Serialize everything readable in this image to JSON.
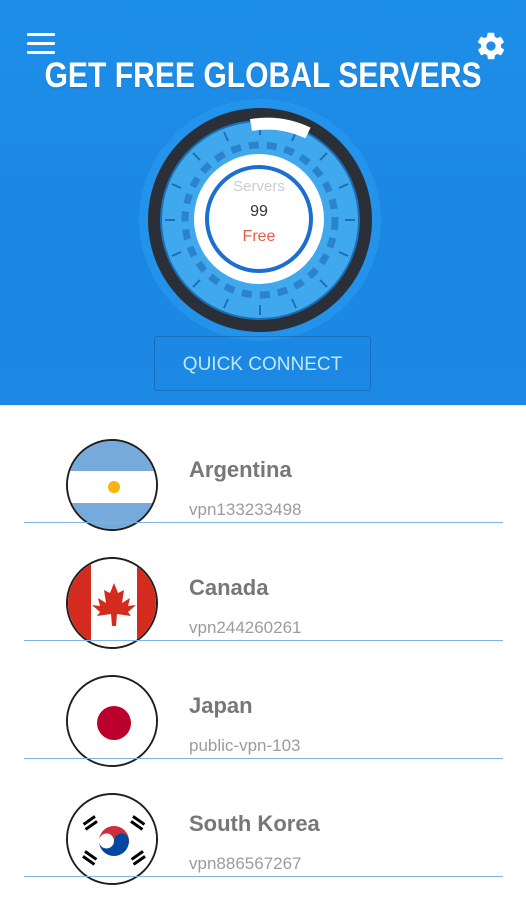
{
  "header": {
    "title": "GET FREE GLOBAL SERVERS",
    "menu_icon": "hamburger-menu-icon",
    "settings_icon": "gear-icon",
    "background_color": "#1e8fe9"
  },
  "gauge": {
    "label": "Servers",
    "count": "99",
    "status": "Free",
    "status_color": "#ea5a4a"
  },
  "quick_connect": {
    "label": "QUICK CONNECT"
  },
  "servers": [
    {
      "country": "Argentina",
      "server": "vpn133233498",
      "flag_icon": "argentina-flag-icon"
    },
    {
      "country": "Canada",
      "server": "vpn244260261",
      "flag_icon": "canada-flag-icon"
    },
    {
      "country": "Japan",
      "server": "public-vpn-103",
      "flag_icon": "japan-flag-icon"
    },
    {
      "country": "South Korea",
      "server": "vpn886567267",
      "flag_icon": "south-korea-flag-icon"
    }
  ]
}
